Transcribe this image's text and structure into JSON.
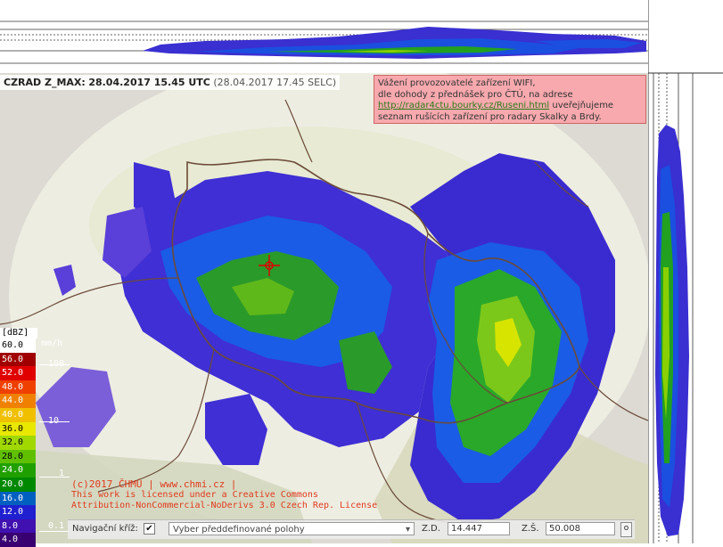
{
  "header": {
    "product": "CZRAD Z_MAX:",
    "time_utc": "28.04.2017 15.45 UTC",
    "time_selc": "(28.04.2017 17.45 SELC)"
  },
  "notice": {
    "line1": "Vážení provozovatelé zařízení WIFI,",
    "line2": "dle dohody z přednášek pro ČTÚ, na adrese",
    "link": "http://radar4ctu.bourky.cz/Ruseni.html",
    "line3_suffix": " uveřejňujeme",
    "line4": "seznam rušících zařízení pro radary Skalky a Brdy."
  },
  "legend": {
    "unit": "[dBZ]",
    "rain_unit": "mm/h",
    "entries": [
      {
        "label": "60.0",
        "color": "#ffffff",
        "text": "#000000"
      },
      {
        "label": "56.0",
        "color": "#a00000",
        "text": "#ffffff"
      },
      {
        "label": "52.0",
        "color": "#e00000",
        "text": "#ffffff"
      },
      {
        "label": "48.0",
        "color": "#f04000",
        "text": "#ffffff"
      },
      {
        "label": "44.0",
        "color": "#f08000",
        "text": "#ffffff"
      },
      {
        "label": "40.0",
        "color": "#f0c000",
        "text": "#ffffff"
      },
      {
        "label": "36.0",
        "color": "#e8e800",
        "text": "#000000"
      },
      {
        "label": "32.0",
        "color": "#a0d800",
        "text": "#000000"
      },
      {
        "label": "28.0",
        "color": "#60c000",
        "text": "#000000"
      },
      {
        "label": "24.0",
        "color": "#20a000",
        "text": "#ffffff"
      },
      {
        "label": "20.0",
        "color": "#008800",
        "text": "#ffffff"
      },
      {
        "label": "16.0",
        "color": "#0060c0",
        "text": "#ffffff"
      },
      {
        "label": "12.0",
        "color": "#2020d0",
        "text": "#ffffff"
      },
      {
        "label": "8.0",
        "color": "#4010b0",
        "text": "#ffffff"
      },
      {
        "label": "4.0",
        "color": "#380070",
        "text": "#ffffff"
      }
    ],
    "rain_ticks": [
      "100",
      "10",
      "1",
      "0.1"
    ]
  },
  "copyright": {
    "line1": "(c)2017 ČHMÚ | www.chmi.cz |",
    "line2": "This work is licensed under a Creative Commons",
    "line3": "Attribution-NonCommercial-NoDerivs 3.0 Czech Rep. License"
  },
  "toolbar": {
    "nav_label": "Navigační kříž:",
    "nav_checked": "✔",
    "preset_placeholder": "Vyber předdefinované polohy",
    "lon_label": "Z.D.",
    "lon_value": "14.447",
    "lat_label": "Z.Š.",
    "lat_value": "50.008",
    "go_label": "o"
  },
  "colors": {
    "notice_bg": "#f7a9ae",
    "copyright": "#e03a1e",
    "crosshair": "#e00000"
  }
}
